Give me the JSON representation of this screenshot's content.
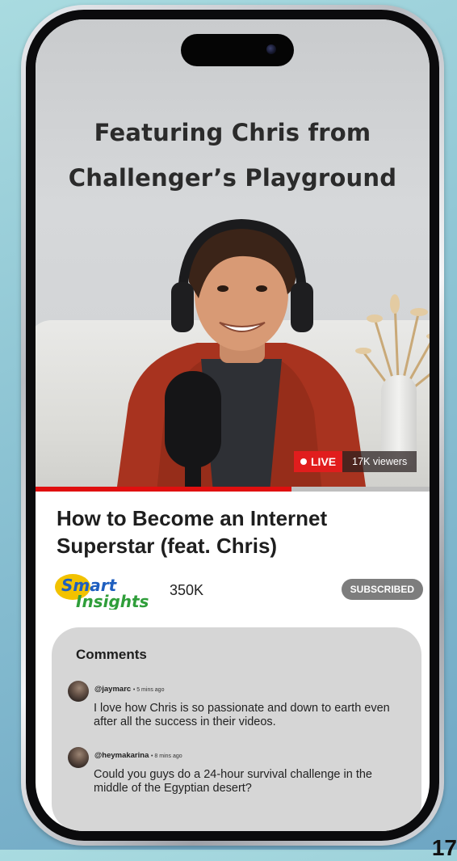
{
  "video": {
    "headline_line1": "Featuring Chris from",
    "headline_line2": "Challenger’s Playground",
    "live_label": "LIVE",
    "viewers": "17K viewers",
    "progress": 0.65
  },
  "content": {
    "title": "How to Become an Internet Superstar (feat. Chris)",
    "channel_logo_line1": "Smart",
    "channel_logo_line2": "Insights",
    "subscriber_count": "350K",
    "subscribe_label": "SUBSCRIBED"
  },
  "comments": {
    "heading": "Comments",
    "items": [
      {
        "handle": "@jaymarc",
        "time": "• 5 mins ago",
        "text": "I love how Chris is so passionate and down to earth even after all the success in their videos."
      },
      {
        "handle": "@heymakarina",
        "time": "• 8 mins ago",
        "text": "Could you guys do a 24-hour survival challenge in the middle of the Egyptian desert?"
      }
    ]
  },
  "page_number": "17",
  "colors": {
    "live_red": "#e11d1d",
    "progress_red": "#e00f0f",
    "subscribed_gray": "#7d7d7d",
    "comments_panel": "#d6d6d6",
    "logo_blue": "#1f5fbf",
    "logo_green": "#2f9e3a",
    "logo_yellow": "#f2c200"
  }
}
